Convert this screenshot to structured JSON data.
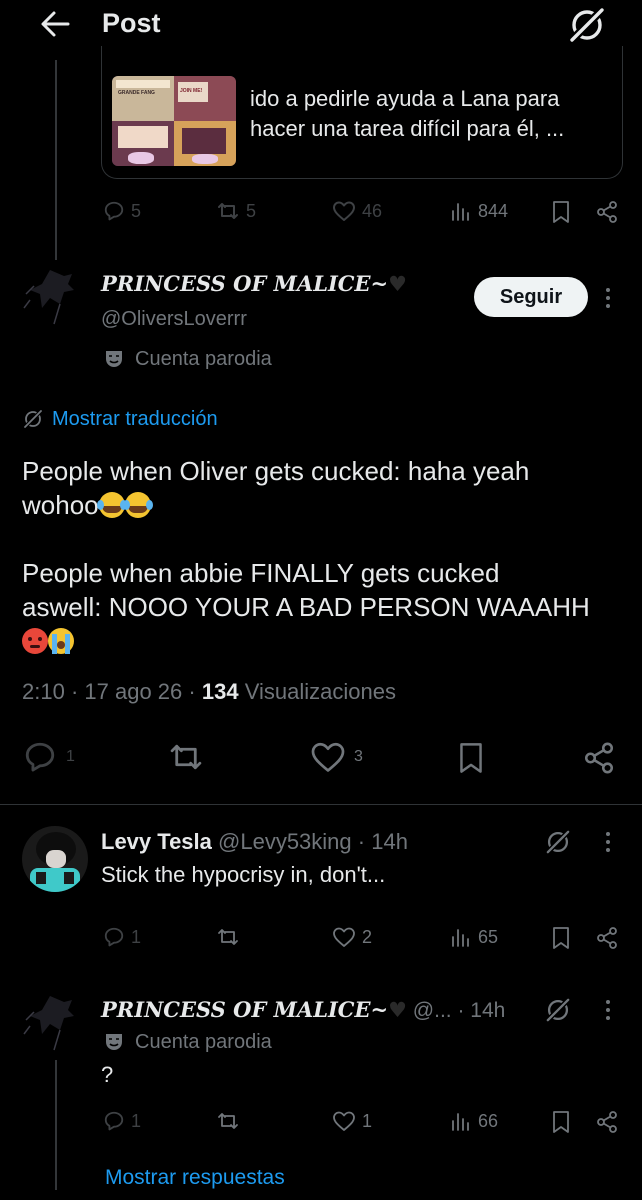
{
  "header": {
    "back_icon": "arrow-left-icon",
    "title": "Post",
    "grok_icon": "grok-icon"
  },
  "quoted_card": {
    "text_line1": "ido a pedirle ayuda a Lana para",
    "text_line2": "hacer una tarea difícil para él, ...",
    "thumb_captions": [
      "GRANDE FANG",
      "JOIN ME!"
    ]
  },
  "parent_actions": {
    "replies": "5",
    "reposts": "5",
    "likes": "46",
    "views": "844"
  },
  "main_post": {
    "display_name": "PRINCESS OF MALICE~",
    "handle": "@OliversLoverrr",
    "follow_label": "Seguir",
    "parody_label": "Cuenta parodia",
    "translate_label": "Mostrar traducción",
    "body_p1_line1": "People when Oliver gets cucked: haha yeah",
    "body_p1_line2": "wohoo",
    "body_p2_line1": "People when abbie FINALLY gets cucked",
    "body_p2_line2": "aswell: NOOO YOUR A BAD PERSON WAAAHH",
    "time": "2:10",
    "date": "17 ago 26",
    "views_count": "134",
    "views_label": "Visualizaciones",
    "actions": {
      "replies": "1",
      "likes": "3"
    }
  },
  "reply1": {
    "display_name": "Levy Tesla",
    "handle": "@Levy53king",
    "time": "14h",
    "text": "Stick the hypocrisy in, don't...",
    "actions": {
      "replies": "1",
      "reposts": "",
      "likes": "2",
      "views": "65"
    }
  },
  "reply2": {
    "display_name": "PRINCESS OF MALICE~",
    "handle": "@...",
    "time": "14h",
    "parody_label": "Cuenta parodia",
    "text": "?",
    "actions": {
      "replies": "1",
      "likes": "1",
      "views": "66"
    }
  },
  "show_replies_label": "Mostrar respuestas",
  "colors": {
    "background": "#000000",
    "text": "#e7e9ea",
    "muted": "#71767b",
    "link": "#1d9bf0",
    "divider": "#2f3336"
  }
}
